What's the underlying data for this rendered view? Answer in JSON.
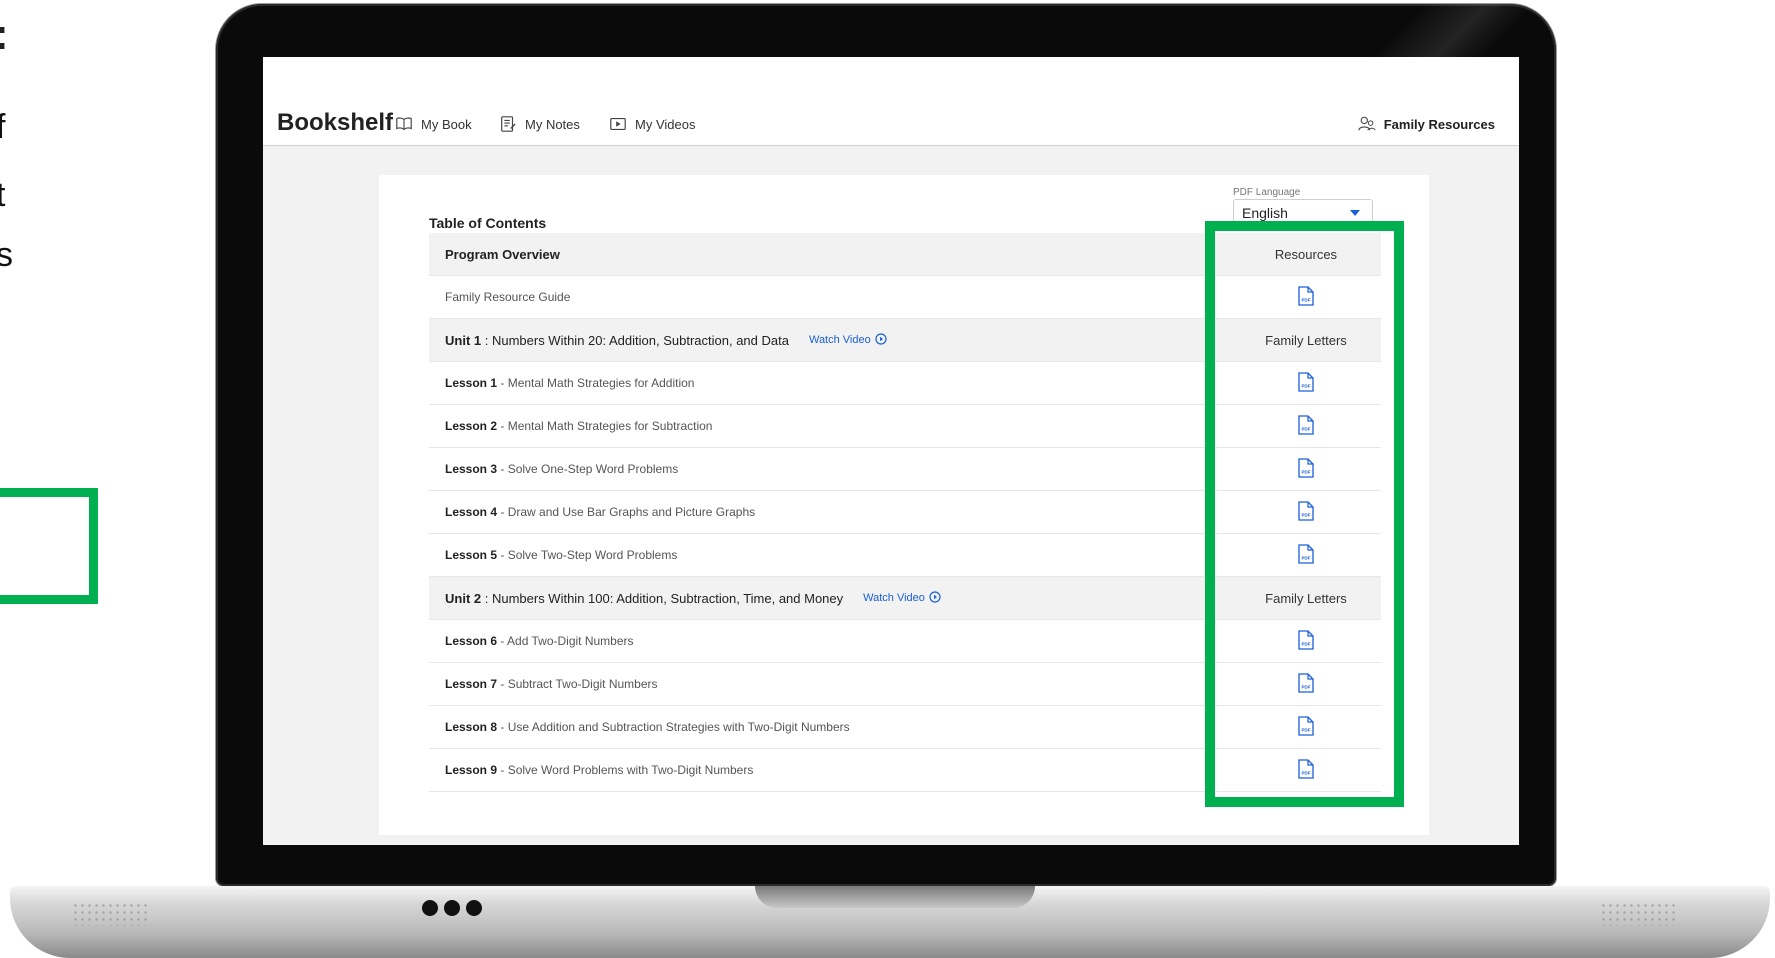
{
  "left_fragment": {
    "glyphs": [
      ":",
      "f",
      "t",
      "s"
    ]
  },
  "app": {
    "brand": "Bookshelf",
    "nav": [
      {
        "label": "My Book",
        "icon": "book-icon"
      },
      {
        "label": "My Notes",
        "icon": "notes-icon"
      },
      {
        "label": "My Videos",
        "icon": "video-icon"
      }
    ],
    "family_resources": {
      "label": "Family Resources",
      "icon": "users-icon"
    }
  },
  "toc": {
    "title": "Table of Contents",
    "pdf_language": {
      "label": "PDF Language",
      "value": "English"
    },
    "rows": [
      {
        "type": "header",
        "left_bold": "Program Overview",
        "left_rest": "",
        "watch": "",
        "right": "Resources"
      },
      {
        "type": "item",
        "left_bold": "",
        "left_rest": "Family Resource Guide",
        "pdf": true
      },
      {
        "type": "header",
        "left_bold": "Unit 1",
        "left_rest": " : Numbers Within 20: Addition, Subtraction, and Data",
        "watch": "Watch Video",
        "right": "Family Letters"
      },
      {
        "type": "item",
        "left_bold": "Lesson 1",
        "left_rest": " - Mental Math Strategies for Addition",
        "pdf": true
      },
      {
        "type": "item",
        "left_bold": "Lesson 2",
        "left_rest": " - Mental Math Strategies for Subtraction",
        "pdf": true
      },
      {
        "type": "item",
        "left_bold": "Lesson 3",
        "left_rest": " - Solve One-Step Word Problems",
        "pdf": true
      },
      {
        "type": "item",
        "left_bold": "Lesson 4",
        "left_rest": " - Draw and Use Bar Graphs and Picture Graphs",
        "pdf": true
      },
      {
        "type": "item",
        "left_bold": "Lesson 5",
        "left_rest": " - Solve Two-Step Word Problems",
        "pdf": true
      },
      {
        "type": "header",
        "left_bold": "Unit 2",
        "left_rest": " : Numbers Within 100: Addition, Subtraction, Time, and Money",
        "watch": "Watch Video",
        "right": "Family Letters"
      },
      {
        "type": "item",
        "left_bold": "Lesson 6",
        "left_rest": " - Add Two-Digit Numbers",
        "pdf": true
      },
      {
        "type": "item",
        "left_bold": "Lesson 7",
        "left_rest": " - Subtract Two-Digit Numbers",
        "pdf": true
      },
      {
        "type": "item",
        "left_bold": "Lesson 8",
        "left_rest": " - Use Addition and Subtraction Strategies with Two-Digit Numbers",
        "pdf": true
      },
      {
        "type": "item",
        "left_bold": "Lesson 9",
        "left_rest": " - Solve Word Problems with Two-Digit Numbers",
        "pdf": true
      }
    ]
  },
  "colors": {
    "highlight": "#00b050",
    "link": "#1a5fd6",
    "header_row": "#f2f2f2"
  }
}
